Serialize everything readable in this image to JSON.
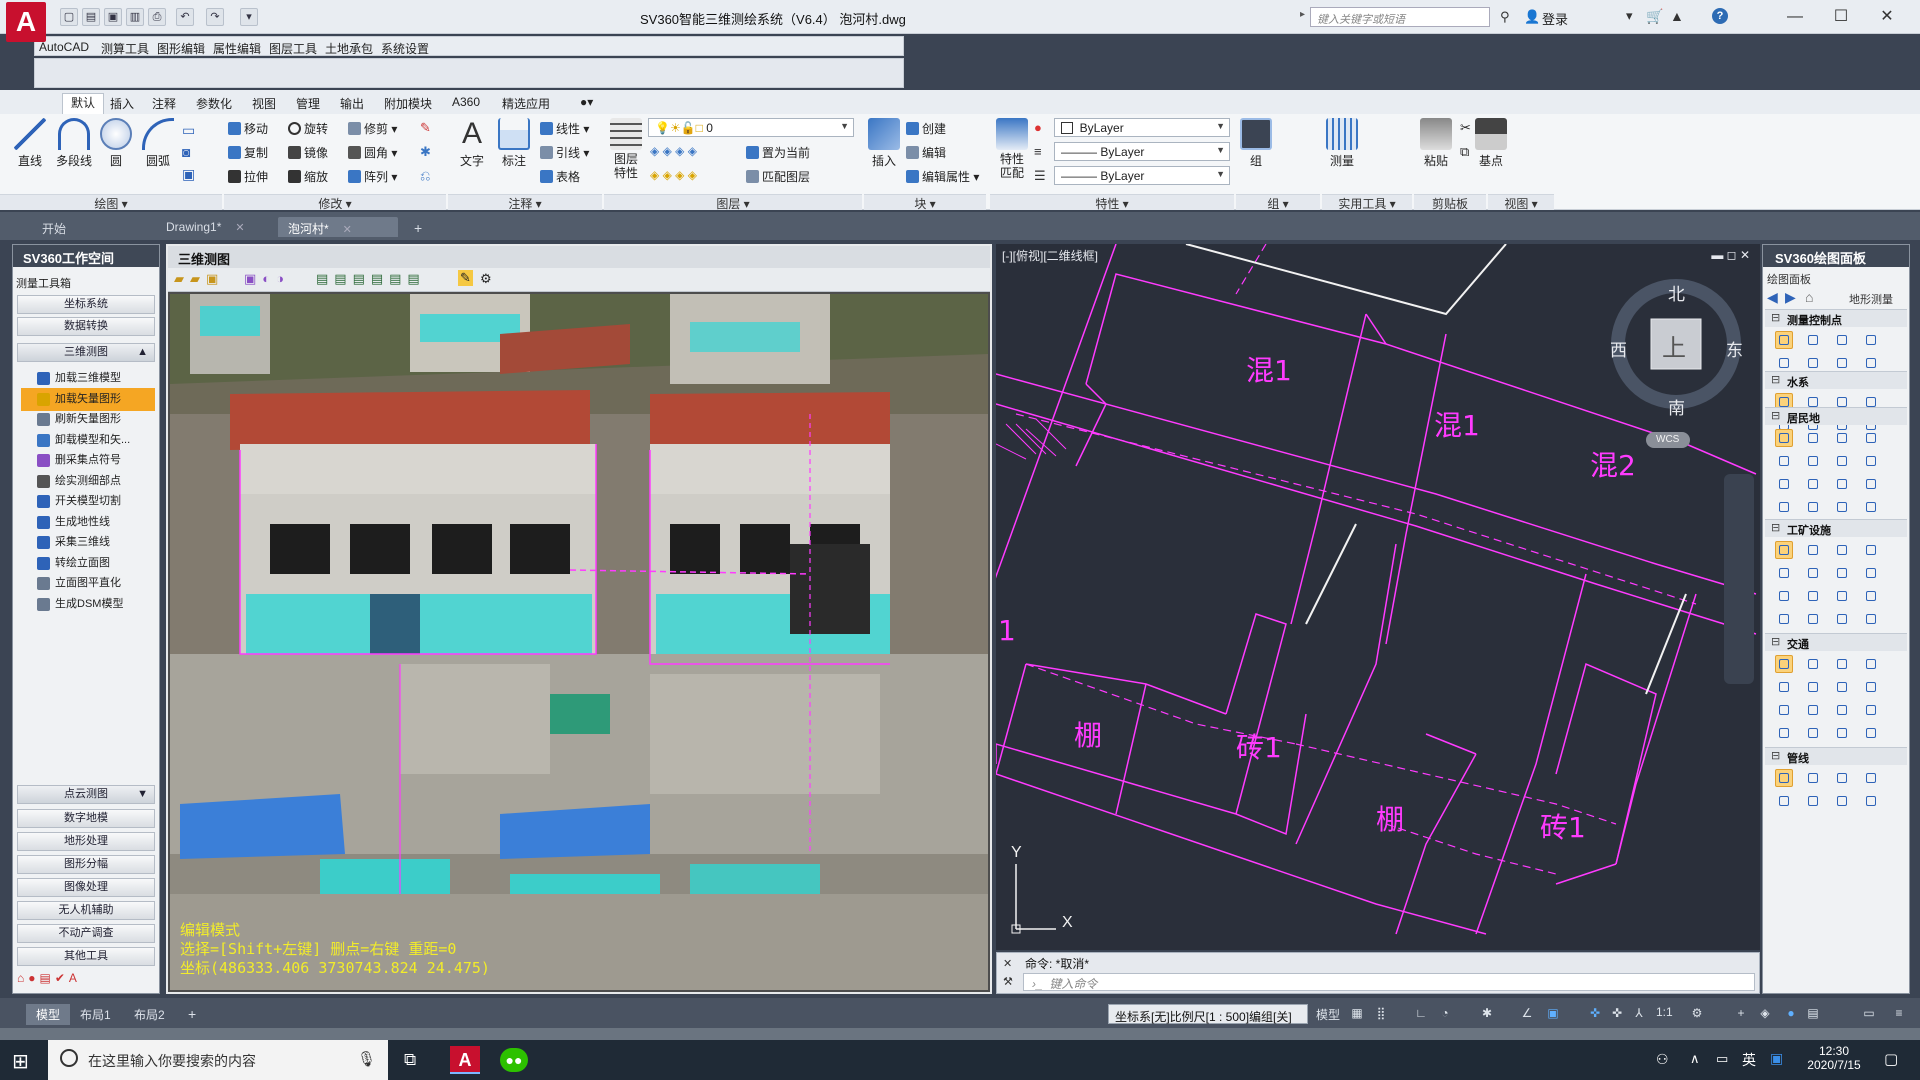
{
  "app": {
    "logo": "A",
    "title": "SV360智能三维测绘系统（V6.4）     泡河村.dwg",
    "search_placeholder": "键入关键字或短语",
    "login": "登录",
    "window_controls": [
      "—",
      "☐",
      "✕"
    ]
  },
  "classic_menu": [
    "AutoCAD",
    "测算工具",
    "图形编辑",
    "属性编辑",
    "图层工具",
    "土地承包",
    "系统设置"
  ],
  "ribbon_tabs": [
    "默认",
    "插入",
    "注释",
    "参数化",
    "视图",
    "管理",
    "输出",
    "附加模块",
    "A360",
    "精选应用"
  ],
  "ribbon": {
    "draw": {
      "line": "直线",
      "polyline": "多段线",
      "circle": "圆",
      "arc": "圆弧",
      "label": "绘图 ▾"
    },
    "modify": {
      "move": "移动",
      "rotate": "旋转",
      "trim": "修剪",
      "copy": "复制",
      "mirror": "镜像",
      "fillet": "圆角",
      "stretch": "拉伸",
      "scale": "缩放",
      "array": "阵列",
      "label": "修改 ▾"
    },
    "annotate": {
      "text": "文字",
      "dimension": "标注",
      "linear": "线性",
      "leader": "引线",
      "table": "表格",
      "label": "注释 ▾"
    },
    "layers": {
      "layer_props": "图层\n特性",
      "layer_value": "0",
      "set_current": "置为当前",
      "match_layer": "匹配图层",
      "label": "图层 ▾"
    },
    "block": {
      "insert": "插入",
      "create": "创建",
      "edit": "编辑",
      "edit_attr": "编辑属性",
      "label": "块 ▾"
    },
    "properties": {
      "match": "特性\n匹配",
      "color": "ByLayer",
      "linetype": "ByLayer",
      "lineweight": "ByLayer",
      "label": "特性 ▾"
    },
    "groups": {
      "group": "组",
      "label": "组 ▾"
    },
    "utilities": {
      "measure": "测量",
      "label": "实用工具 ▾"
    },
    "clipboard": {
      "paste": "粘贴",
      "label": "剪贴板"
    },
    "view": {
      "base": "基点",
      "label": "视图 ▾"
    }
  },
  "doc_tabs": [
    "开始",
    "Drawing1*",
    "泡河村*"
  ],
  "left_panel": {
    "title": "SV360工作空间",
    "toolbox": "测量工具箱",
    "top_buttons": [
      "坐标系统",
      "数据转换"
    ],
    "section_3d": "三维测图",
    "items": [
      "加载三维模型",
      "加载矢量图形",
      "刷新矢量图形",
      "卸载模型和矢...",
      "删采集点符号",
      "绘实测细部点",
      "开关模型切割",
      "生成地性线",
      "采集三维线",
      "转绘立面图",
      "立面图平直化",
      "生成DSM模型"
    ],
    "active_index": 1,
    "section_pc": "点云测图",
    "bottom_buttons": [
      "数字地模",
      "地形处理",
      "图形分幅",
      "图像处理",
      "无人机辅助",
      "不动产调查",
      "其他工具"
    ]
  },
  "view3d": {
    "title": "三维测图",
    "status_lines": [
      "编辑模式",
      "选择=[Shift+左键]  删点=右键  重距=0",
      "坐标(486333.406  3730743.824  24.475)"
    ]
  },
  "cadview": {
    "label": "[-][俯视][二维线框]",
    "compass": {
      "north": "北",
      "south": "南",
      "east": "东",
      "west": "西",
      "top": "上",
      "wcs": "WCS"
    },
    "labels": [
      "混1",
      "混1",
      "混2",
      "棚",
      "砖1",
      "棚",
      "砖1",
      "1"
    ],
    "axis_x": "X",
    "axis_y": "Y"
  },
  "cmdline": {
    "history": "命令: *取消*",
    "placeholder": "键入命令"
  },
  "right_panel": {
    "title": "SV360绘图面板",
    "subtitle": "绘图面板",
    "nav_label": "地形测量",
    "sections": [
      "测量控制点",
      "水系",
      "居民地",
      "工矿设施",
      "交通",
      "管线"
    ]
  },
  "statusbar": {
    "tabs": [
      "模型",
      "布局1",
      "布局2"
    ],
    "coord": "坐标系[无]比例尺[1 : 500]编组[关]",
    "model_label": "模型",
    "scale": "1:1"
  },
  "taskbar": {
    "search": "在这里输入你要搜索的内容",
    "time": "12:30",
    "date": "2020/7/15",
    "ime": "英"
  }
}
